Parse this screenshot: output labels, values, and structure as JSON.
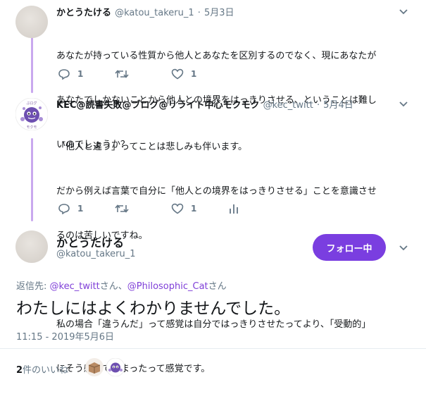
{
  "colors": {
    "accent": "#7a3ee0",
    "link": "#7f3fd8",
    "muted": "#657786",
    "thread_line": "#c9a8ee"
  },
  "tweet1": {
    "name": "かとうたける",
    "handle": "@katou_takeru_1",
    "date": "5月3日",
    "lines": [
      "あなたが持っている性質から他人とあなたを区別するのでなく、現にあなたが",
      "あなたでしかないことから他人との境界をはっきりさせる、ということは難し",
      "いのでしょうか？"
    ],
    "reply_count": "1",
    "like_count": "1"
  },
  "tweet2": {
    "name": "KEC@読書失敗@ブログ@リライト中心モクモク",
    "handle": "@kec_twitt",
    "date": "5月4日",
    "lines": [
      "「他人と違う」ってことは悲しみも伴います。",
      "だから例えば言葉で自分に「他人との境界をはっきりさせる」ことを意識させ",
      "るのは苦しいですね。",
      "",
      "私の場合「違うんだ」って感覚は自分ではっきりさせたってより、「受動的」",
      "にそう感じてしまったって感覚です。"
    ],
    "reply_count": "1",
    "like_count": "1"
  },
  "main": {
    "name": "かとうたける",
    "handle": "@katou_takeru_1",
    "follow_label": "フォロー中",
    "reply_prefix": "返信先: ",
    "reply_user1": "@kec_twitt",
    "reply_san1": "さん、",
    "reply_user2": "@Philosophic_Cat",
    "reply_san2": "さん",
    "text": "わたしにはよくわかりませんでした。",
    "timestamp": "11:15 - 2019年5月6日",
    "likes_count": "2",
    "likes_label": "件のいいね"
  },
  "icons": [
    "reply-icon",
    "retweet-icon",
    "like-icon",
    "analytics-icon",
    "chevron-down-icon"
  ]
}
